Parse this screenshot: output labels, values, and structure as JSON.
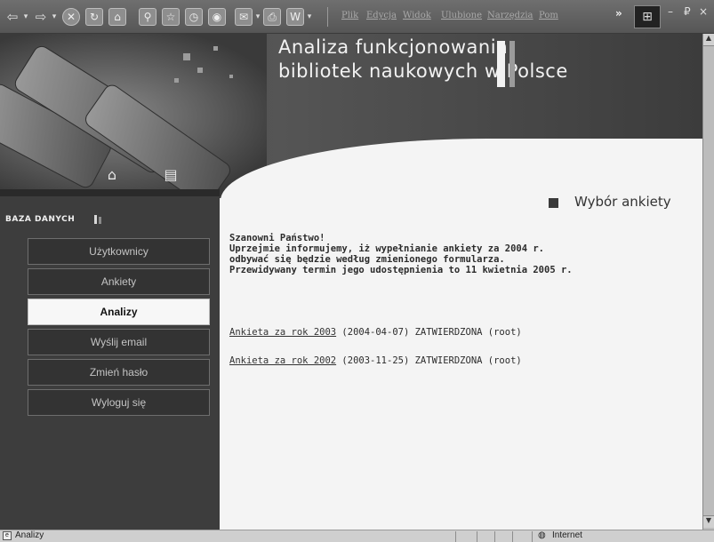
{
  "browser": {
    "menu": [
      "Plik",
      "Edycja",
      "Widok",
      "Ulubione",
      "Narzędzia",
      "Pom"
    ],
    "toolbar_overflow": "»",
    "controls": {
      "minimize": "–",
      "restore": "₽",
      "close": "×"
    }
  },
  "site": {
    "title_line1": "Analiza funkcjonowania",
    "title_line2": "bibliotek naukowych w Polsce"
  },
  "sidebar": {
    "heading": "BAZA DANYCH",
    "items": [
      {
        "label": "Użytkownicy",
        "active": false
      },
      {
        "label": "Ankiety",
        "active": false
      },
      {
        "label": "Analizy",
        "active": true
      },
      {
        "label": "Wyślij email",
        "active": false
      },
      {
        "label": "Zmień hasło",
        "active": false
      },
      {
        "label": "Wyloguj się",
        "active": false
      }
    ]
  },
  "content": {
    "section_title": "Wybór ankiety",
    "notice": "Szanowni Państwo!\nUprzejmie informujemy, iż wypełnianie ankiety za 2004 r.\nodbywać się będzie według zmienionego formularza.\nPrzewidywany termin jego udostępnienia to 11 kwietnia 2005 r.",
    "surveys": [
      {
        "link": "Ankieta za rok 2003",
        "details": " (2004-04-07) ZATWIERDZONA (root)"
      },
      {
        "link": "Ankieta za rok 2002",
        "details": " (2003-11-25) ZATWIERDZONA (root)"
      }
    ]
  },
  "statusbar": {
    "text": "Analizy",
    "zone": "Internet"
  }
}
